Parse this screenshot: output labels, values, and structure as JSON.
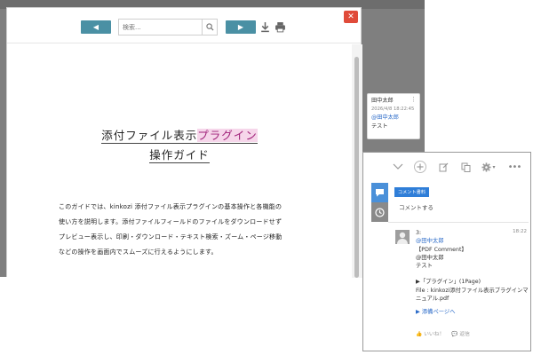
{
  "viewer": {
    "search_placeholder": "検索...",
    "doc_title_line1_prefix": "添付ファイル表示",
    "doc_title_line1_highlight": "プラグイン",
    "doc_title_line2": "操作ガイド",
    "body_lines": [
      "このガイドでは、kinkozi 添付ファイル表示プラグインの基本操作と各機能の",
      "使い方を説明します。添付ファイルフィールドのファイルをダウンロードせず",
      "プレビュー表示し、印刷・ダウンロード・テキスト検索・ズーム・ページ移動",
      "などの操作を画面内でスムーズに行えるようにします。"
    ],
    "colors": {
      "nav_button": "#4a90a4",
      "close_button": "#e04b3a",
      "highlight": "#f6d6ea"
    }
  },
  "pdf_comment": {
    "author": "田中太郎",
    "timestamp": "2026/4/8 18:22:45",
    "mention": "@田中太郎",
    "text": "テスト"
  },
  "panel": {
    "post_button_label": "コメント書料",
    "input_placeholder": "コメントする",
    "entry": {
      "number": "3:",
      "time": "18:22",
      "mention": "@田中太郎",
      "tag": "【PDF Comment】",
      "mention2": "@田中太郎",
      "text": "テスト",
      "page_ref": "▶「プラグイン」(1Page)",
      "file_line": "File : kinkozi添付ファイル表示プラグインマニュアル.pdf",
      "link": "▶ 添備ページへ",
      "like": "いいね！",
      "reply": "返信"
    },
    "colors": {
      "active_tab": "#4a90d9",
      "inactive_tab": "#8a8a8a",
      "post_button": "#2f7ed8"
    }
  }
}
